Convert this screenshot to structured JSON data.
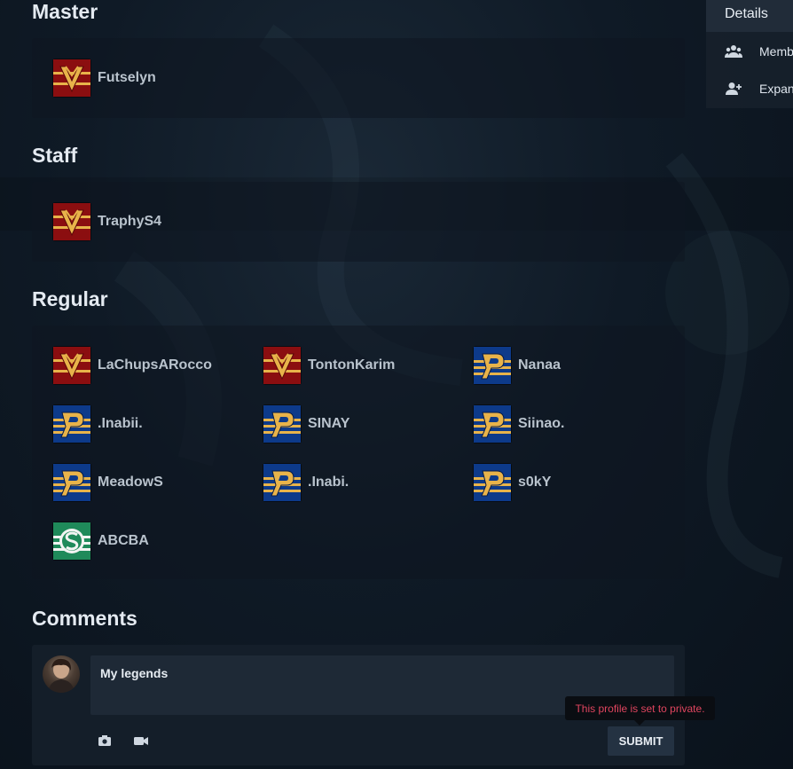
{
  "sections": {
    "master": {
      "title": "Master"
    },
    "staff": {
      "title": "Staff"
    },
    "regular": {
      "title": "Regular"
    },
    "comments": {
      "title": "Comments"
    }
  },
  "members": {
    "master": [
      {
        "name": "Futselyn",
        "rank_icon": "crimson-v-rank-icon"
      }
    ],
    "staff": [
      {
        "name": "TraphyS4",
        "rank_icon": "crimson-v-rank-icon"
      }
    ],
    "regular": [
      {
        "name": "LaChupsARocco",
        "rank_icon": "crimson-v-rank-icon"
      },
      {
        "name": "TontonKarim",
        "rank_icon": "crimson-v-rank-icon"
      },
      {
        "name": "Nanaa",
        "rank_icon": "blue-p-rank-icon"
      },
      {
        "name": ".Inabii.",
        "rank_icon": "blue-p-rank-icon"
      },
      {
        "name": "SINAY",
        "rank_icon": "blue-p-rank-icon"
      },
      {
        "name": "Siinao.",
        "rank_icon": "blue-p-rank-icon"
      },
      {
        "name": "MeadowS",
        "rank_icon": "blue-p-rank-icon"
      },
      {
        "name": ".Inabi.",
        "rank_icon": "blue-p-rank-icon"
      },
      {
        "name": "s0kY",
        "rank_icon": "blue-p-rank-icon"
      },
      {
        "name": "ABCBA",
        "rank_icon": "green-s-rank-icon"
      }
    ]
  },
  "details": {
    "heading": "Details",
    "items": [
      {
        "label": "Members",
        "icon": "members-icon"
      },
      {
        "label": "Expand",
        "icon": "add-user-icon"
      }
    ]
  },
  "comment_form": {
    "value": "My legends",
    "submit_label": "SUBMIT",
    "tooltip": "This profile is set to private.",
    "tools": [
      "camera-icon",
      "video-icon"
    ]
  },
  "colors": {
    "crimson": "#8b0e10",
    "gold": "#e8b34a",
    "blue": "#0d3a8a",
    "green": "#1f8a5a",
    "tooltip_text": "#e0455f"
  }
}
